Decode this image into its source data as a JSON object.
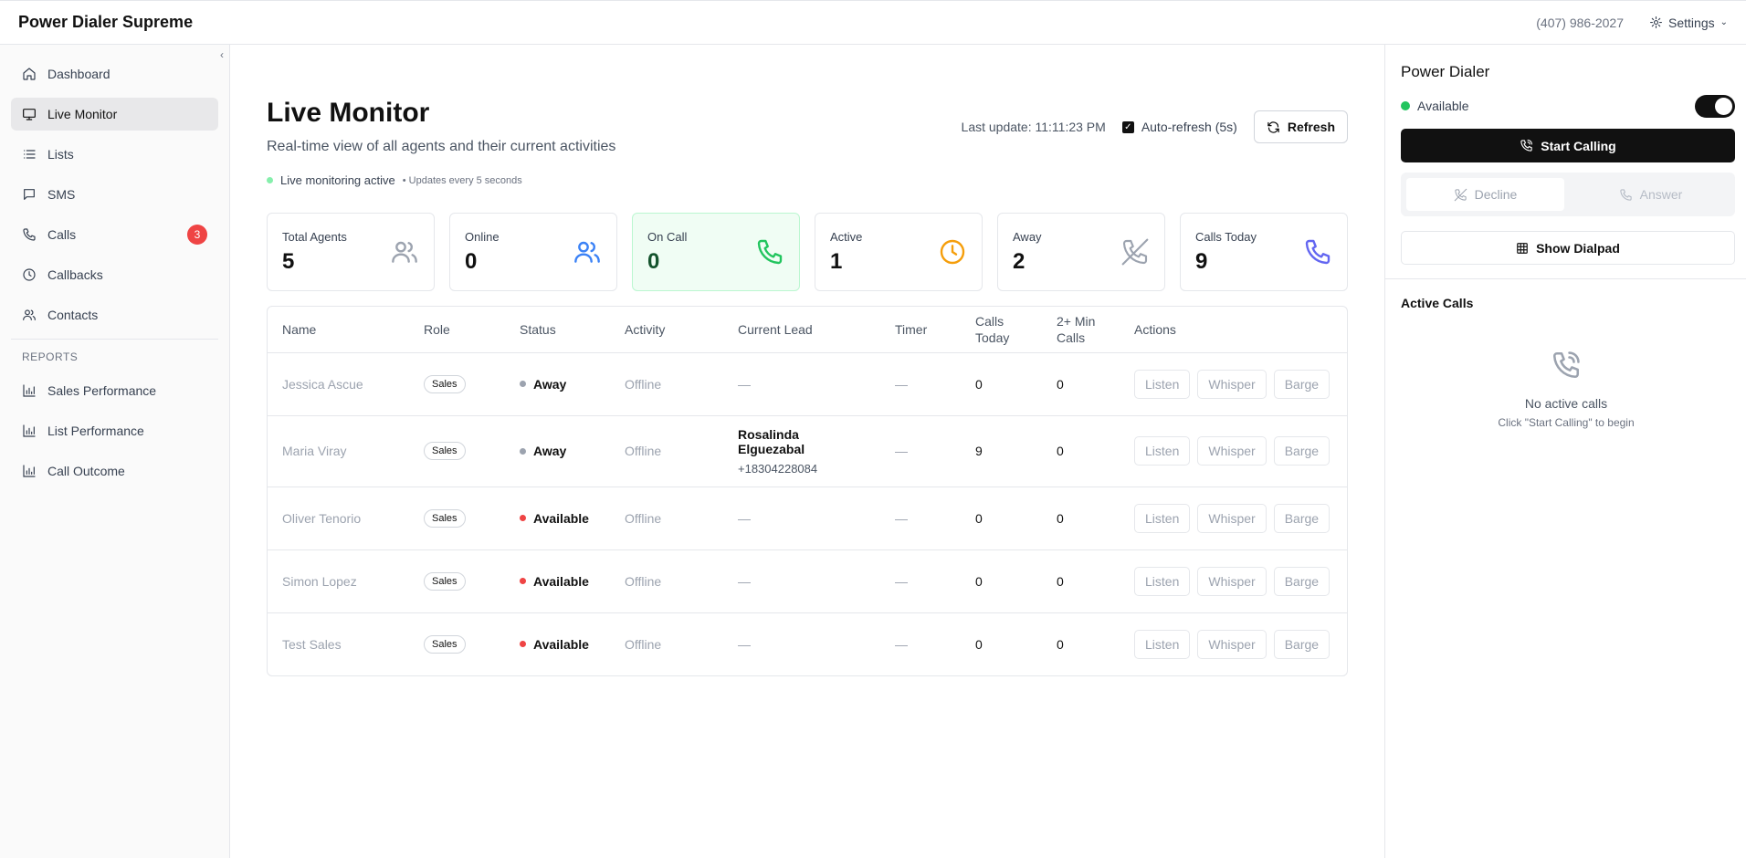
{
  "app": {
    "title": "Power Dialer Supreme"
  },
  "topbar": {
    "phone": "(407) 986-2027",
    "settings_label": "Settings"
  },
  "sidebar": {
    "collapse_glyph": "‹",
    "items": [
      {
        "label": "Dashboard",
        "icon": "home-icon"
      },
      {
        "label": "Live Monitor",
        "icon": "monitor-icon",
        "active": true
      },
      {
        "label": "Lists",
        "icon": "list-icon"
      },
      {
        "label": "SMS",
        "icon": "message-icon"
      },
      {
        "label": "Calls",
        "icon": "phone-icon",
        "badge": "3"
      },
      {
        "label": "Callbacks",
        "icon": "clock-icon"
      },
      {
        "label": "Contacts",
        "icon": "users-icon"
      }
    ],
    "reports_label": "REPORTS",
    "reports": [
      {
        "label": "Sales Performance",
        "icon": "bar-chart-icon"
      },
      {
        "label": "List Performance",
        "icon": "bar-chart-icon"
      },
      {
        "label": "Call Outcome",
        "icon": "bar-chart-icon"
      }
    ]
  },
  "main": {
    "title": "Live Monitor",
    "subtitle": "Real-time view of all agents and their current activities",
    "live_status": "Live monitoring active",
    "live_sub": "• Updates every 5 seconds",
    "last_update": "Last update: 11:11:23 PM",
    "auto_refresh_label": "Auto-refresh (5s)",
    "auto_refresh_checked": true,
    "refresh_label": "Refresh",
    "stats": [
      {
        "label": "Total Agents",
        "value": "5",
        "icon": "users-icon",
        "color": "#9ca3af"
      },
      {
        "label": "Online",
        "value": "0",
        "icon": "users-icon",
        "color": "#3b82f6"
      },
      {
        "label": "On Call",
        "value": "0",
        "icon": "phone-icon",
        "color": "#22c55e",
        "highlight": true
      },
      {
        "label": "Active",
        "value": "1",
        "icon": "clock-icon",
        "color": "#f59e0b"
      },
      {
        "label": "Away",
        "value": "2",
        "icon": "phone-off-icon",
        "color": "#9ca3af"
      },
      {
        "label": "Calls Today",
        "value": "9",
        "icon": "phone-icon",
        "color": "#6366f1"
      }
    ],
    "table": {
      "headers": [
        "Name",
        "Role",
        "Status",
        "Activity",
        "Current Lead",
        "Timer",
        "Calls Today",
        "2+ Min Calls",
        "Actions"
      ],
      "action_labels": [
        "Listen",
        "Whisper",
        "Barge"
      ],
      "rows": [
        {
          "name": "Jessica Ascue",
          "role": "Sales",
          "status": "Away",
          "status_color": "#9ca3af",
          "activity": "Offline",
          "lead_name": "—",
          "lead_phone": "",
          "timer": "—",
          "calls_today": "0",
          "two_min": "0"
        },
        {
          "name": "Maria Viray",
          "role": "Sales",
          "status": "Away",
          "status_color": "#9ca3af",
          "activity": "Offline",
          "lead_name": "Rosalinda Elguezabal",
          "lead_phone": "+18304228084",
          "timer": "—",
          "calls_today": "9",
          "two_min": "0"
        },
        {
          "name": "Oliver Tenorio",
          "role": "Sales",
          "status": "Available",
          "status_color": "#ef4444",
          "activity": "Offline",
          "lead_name": "—",
          "lead_phone": "",
          "timer": "—",
          "calls_today": "0",
          "two_min": "0"
        },
        {
          "name": "Simon Lopez",
          "role": "Sales",
          "status": "Available",
          "status_color": "#ef4444",
          "activity": "Offline",
          "lead_name": "—",
          "lead_phone": "",
          "timer": "—",
          "calls_today": "0",
          "two_min": "0"
        },
        {
          "name": "Test Sales",
          "role": "Sales",
          "status": "Available",
          "status_color": "#ef4444",
          "activity": "Offline",
          "lead_name": "—",
          "lead_phone": "",
          "timer": "—",
          "calls_today": "0",
          "two_min": "0"
        }
      ]
    }
  },
  "dialer": {
    "title": "Power Dialer",
    "status": "Available",
    "toggle_on": true,
    "start_label": "Start Calling",
    "decline_label": "Decline",
    "answer_label": "Answer",
    "dialpad_label": "Show Dialpad",
    "active_calls_title": "Active Calls",
    "empty_title": "No active calls",
    "empty_sub": "Click \"Start Calling\" to begin"
  },
  "colors": {
    "accent": "#111111",
    "live": "#86efac",
    "available": "#22c55e",
    "badge": "#ef4444"
  }
}
